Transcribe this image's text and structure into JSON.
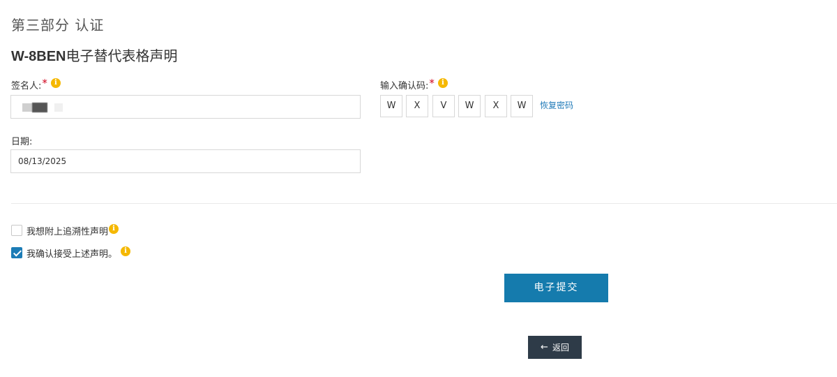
{
  "section": {
    "title": "第三部分 认证"
  },
  "form_title": {
    "bold": "W-8BEN",
    "rest": "电子替代表格声明"
  },
  "signer": {
    "label": "签名人:",
    "required_mark": "*",
    "info_icon": "info-icon"
  },
  "date": {
    "label": "日期:",
    "value": "08/13/2025"
  },
  "verification": {
    "label": "输入确认码:",
    "required_mark": "*",
    "code_chars": [
      "W",
      "X",
      "V",
      "W",
      "X",
      "W"
    ],
    "recover_link": "恢复密码"
  },
  "checkboxes": [
    {
      "label": "我想附上追溯性声明",
      "checked": false
    },
    {
      "label": "我确认接受上述声明。",
      "checked": true
    }
  ],
  "buttons": {
    "submit": "电子提交",
    "back": "返回"
  },
  "colors": {
    "primary": "#157bad",
    "back_button": "#2e3b48",
    "info": "#f5b800",
    "required": "#d0021b",
    "link": "#1f7ab8"
  }
}
